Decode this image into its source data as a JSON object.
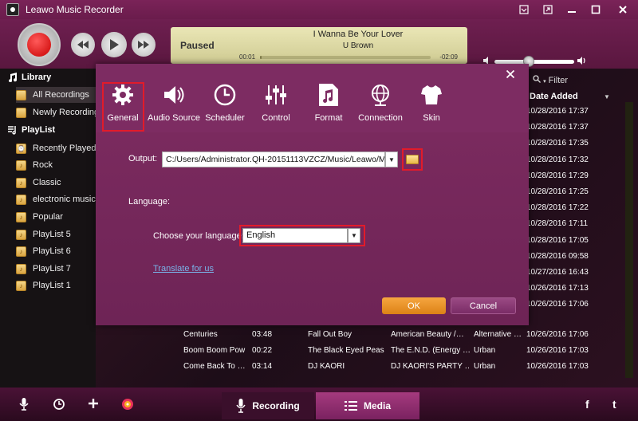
{
  "window": {
    "title": "Leawo Music Recorder",
    "buttons": {
      "minimize_icon": "minimize-icon",
      "maximize_icon": "maximize-icon",
      "close_icon": "close-icon"
    }
  },
  "player": {
    "status": "Paused",
    "song": "I Wanna Be Your Lover",
    "artist": "U Brown",
    "elapsed": "00:01",
    "remaining": "-02:09",
    "progress_fraction": 0.01,
    "volume_fraction": 0.42
  },
  "sidebar": {
    "library_label": "Library",
    "library_items": [
      {
        "label": "All Recordings"
      },
      {
        "label": "Newly Recording"
      }
    ],
    "playlist_label": "PlayList",
    "playlist_items": [
      {
        "label": "Recently Played"
      },
      {
        "label": "Rock"
      },
      {
        "label": "Classic"
      },
      {
        "label": "electronic music"
      },
      {
        "label": "Popular"
      },
      {
        "label": "PlayList 5"
      },
      {
        "label": "PlayList 6"
      },
      {
        "label": "PlayList 7"
      },
      {
        "label": "PlayList 1"
      }
    ]
  },
  "table": {
    "filter_label": "Filter",
    "date_header": "Date Added",
    "dates_visible": [
      "10/28/2016 17:37",
      "10/28/2016 17:37",
      "10/28/2016 17:35",
      "10/28/2016 17:32",
      "10/28/2016 17:29",
      "10/28/2016 17:25",
      "10/28/2016 17:22",
      "10/28/2016 17:11",
      "10/28/2016 17:05",
      "10/28/2016 09:58",
      "10/27/2016 16:43",
      "10/26/2016 17:13",
      "10/26/2016 17:06"
    ],
    "rows": [
      {
        "title": "Centuries",
        "duration": "03:48",
        "artist": "Fall Out Boy",
        "album": "American Beauty /…",
        "genre": "Alternative …",
        "date": "10/26/2016 17:06"
      },
      {
        "title": "Boom Boom Pow",
        "duration": "00:22",
        "artist": "The Black Eyed Peas",
        "album": "The E.N.D. (Energy …",
        "genre": "Urban",
        "date": "10/26/2016 17:03"
      },
      {
        "title": "Come Back To …",
        "duration": "03:14",
        "artist": "DJ KAORI",
        "album": "DJ KAORI'S PARTY …",
        "genre": "Urban",
        "date": "10/26/2016 17:03"
      }
    ]
  },
  "dialog": {
    "tabs": [
      {
        "label": "General",
        "icon": "gear-icon"
      },
      {
        "label": "Audio Source",
        "icon": "speaker-icon"
      },
      {
        "label": "Scheduler",
        "icon": "clock-icon"
      },
      {
        "label": "Control",
        "icon": "sliders-icon"
      },
      {
        "label": "Format",
        "icon": "music-file-icon"
      },
      {
        "label": "Connection",
        "icon": "globe-icon"
      },
      {
        "label": "Skin",
        "icon": "shirt-icon"
      }
    ],
    "output_label": "Output:",
    "output_value": "C:/Users/Administrator.QH-20151113VZCZ/Music/Leawo/M",
    "language_section": "Language:",
    "choose_language_label": "Choose your language:",
    "language_value": "English",
    "translate_link": "Translate for us",
    "ok_label": "OK",
    "cancel_label": "Cancel"
  },
  "bottombar": {
    "recording_label": "Recording",
    "media_label": "Media"
  },
  "colors": {
    "accent_purple": "#7d2c62",
    "highlight_red": "#e21b2a",
    "ok_orange": "#e88f22",
    "link_blue": "#79b3e8"
  }
}
